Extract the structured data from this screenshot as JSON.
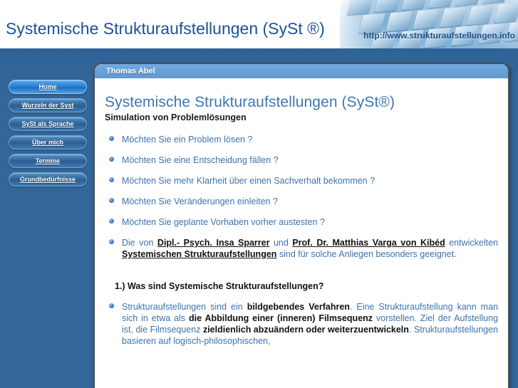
{
  "banner": {
    "title": "Systemische Strukturaufstellungen (SySt ®)",
    "url": "http://www.strukturaufstellungen.info",
    "photo_name": "keyboard-photo"
  },
  "sidebar": {
    "items": [
      {
        "label": "Home",
        "active": true
      },
      {
        "label": "Wurzeln der Syst",
        "active": false
      },
      {
        "label": "SySt als Sprache",
        "active": false
      },
      {
        "label": "Über mich",
        "active": false
      },
      {
        "label": "Termine",
        "active": false
      },
      {
        "label": "Grundbedürfnisse",
        "active": false
      }
    ]
  },
  "panel": {
    "titlebar": "Thomas Abel",
    "doc_title": "Systemische Strukturaufstellungen (SySt®)",
    "doc_subtitle": "Simulation von Problemlösungen",
    "questions": [
      "Möchten Sie ein Problem lösen ?",
      "Möchten Sie eine Entscheidung fällen ?",
      "Möchten Sie mehr Klarheit über einen Sachverhalt bekommen ?",
      "Möchten Sie Veränderungen einleiten ?",
      "Möchten Sie geplante Vorhaben vorher austesten ?"
    ],
    "intro_paragraph": {
      "t1": "Die von ",
      "u1": "Dipl.- Psych. Insa Sparrer",
      "t2": " und ",
      "u2": "Prof. Dr. Matthias Varga von Kibéd",
      "t3": " entwickelten ",
      "u3": "Systemischen Strukturaufstellungen",
      "t4": " sind für solche Anliegen besonders geeignet."
    },
    "section_heading": "1.) Was sind Systemische Strukturaufstellungen?",
    "body_paragraph": {
      "b1": "Strukturaufstellungen sind ein ",
      "k1": "bildgebendes Verfahren",
      "b2": ". Eine Strukturaufstellung kann man sich in etwa als ",
      "k2": "die Abbildung einer (inneren) Filmsequenz",
      "b3": " vorstellen. Ziel der Aufstellung ist, die Filmsequenz ",
      "k3": "zieldienlich   abzuändern oder weiterzuentwickeln",
      "b4": ". Strukturaufstellungen basieren auf logisch-philosophischen,"
    }
  },
  "colors": {
    "page_blue": "#336699",
    "link_blue": "#3d73ad",
    "title_blue": "#3f77af",
    "banner_blue": "#1b5294",
    "panel_titlebar": "#6aa2d8"
  }
}
